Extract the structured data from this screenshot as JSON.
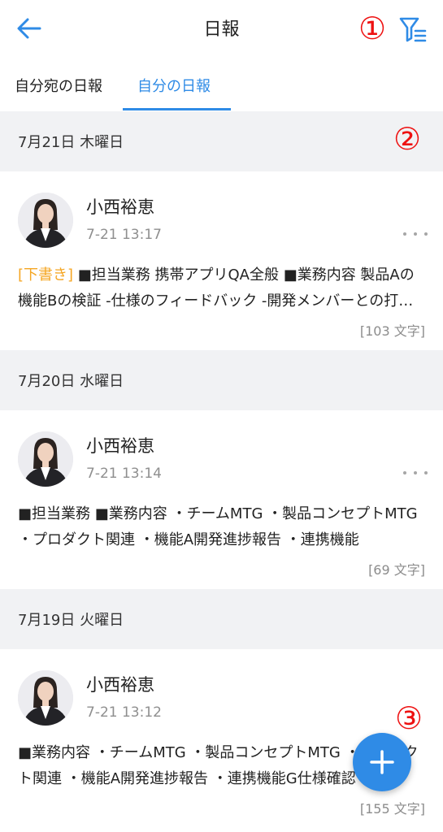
{
  "header": {
    "title": "日報",
    "back_icon": "arrow-left-icon",
    "filter_icon": "filter-icon",
    "annotation_1": "①"
  },
  "tabs": [
    {
      "label": "自分宛の日報",
      "active": false
    },
    {
      "label": "自分の日報",
      "active": true
    }
  ],
  "annotations": {
    "a2": "②",
    "a3": "③"
  },
  "colors": {
    "accent": "#2f8be6",
    "draft": "#f5a623",
    "annotation": "#e11111",
    "section_bg": "#f1f2f4"
  },
  "reports": [
    {
      "date": "7月21日 木曜日",
      "author": "小西裕恵",
      "time": "7-21 13:17",
      "draft_label": "[下書き]",
      "text": " ■担当業務 携帯アプリQA全般 ■業務内容 製品Aの機能Bの検証 -仕様のフィードバック -開発メンバーとの打ち合わせ",
      "count": "[103 文字]"
    },
    {
      "date": "7月20日 水曜日",
      "author": "小西裕恵",
      "time": "7-21 13:14",
      "draft_label": "",
      "text": "■担当業務 ■業務内容 ・チームMTG ・製品コンセプトMTG ・プロダクト関連 ・機能A開発進捗報告 ・連携機能",
      "count": "[69 文字]"
    },
    {
      "date": "7月19日 火曜日",
      "author": "小西裕恵",
      "time": "7-21 13:12",
      "draft_label": "",
      "text": "■業務内容 ・チームMTG ・製品コンセプトMTG ・プロダクト関連 ・機能A開発進捗報告 ・連携機能G仕様確認",
      "count": "[155 文字]"
    }
  ],
  "fab": {
    "icon": "plus-icon"
  }
}
